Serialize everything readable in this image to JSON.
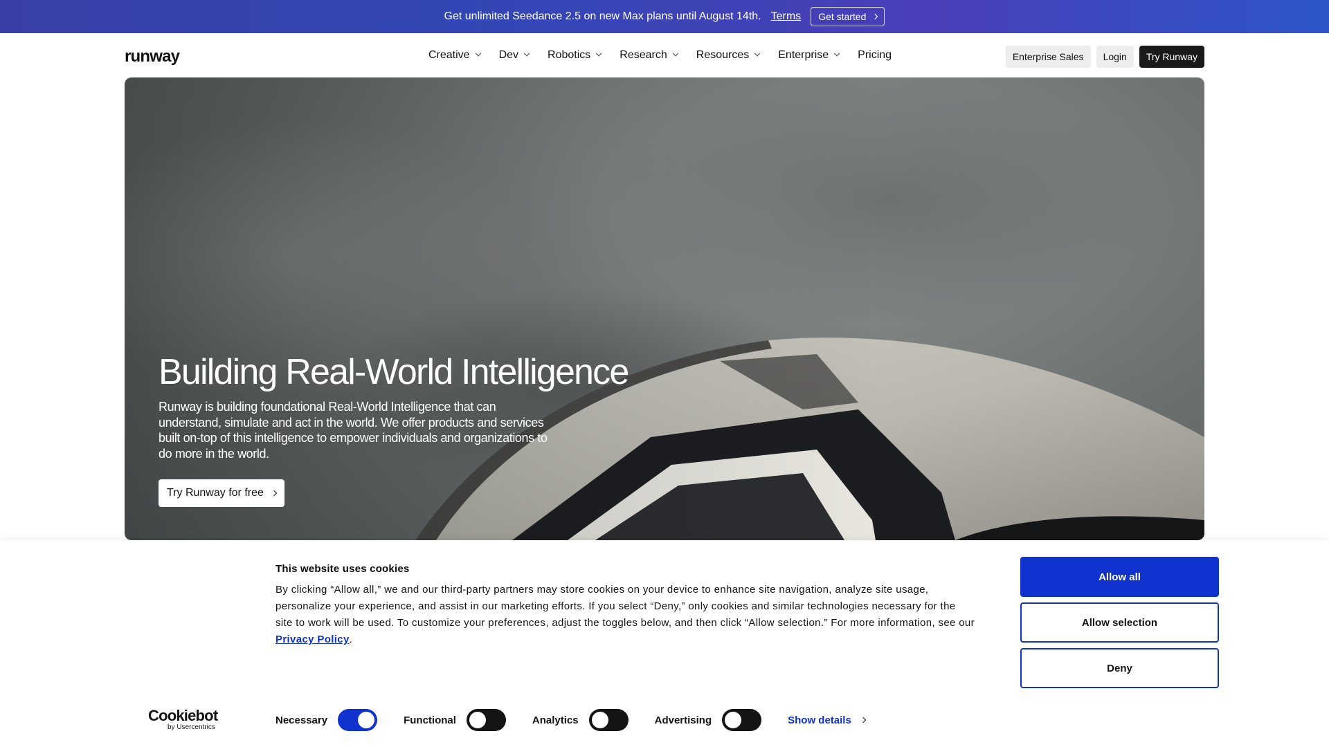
{
  "promo": {
    "text": "Get unlimited Seedance 2.5 on new Max plans until August 14th.",
    "terms": "Terms",
    "cta": "Get started"
  },
  "nav": {
    "logo": "runway",
    "menu": [
      {
        "label": "Creative",
        "has_dropdown": true
      },
      {
        "label": "Dev",
        "has_dropdown": true
      },
      {
        "label": "Robotics",
        "has_dropdown": true
      },
      {
        "label": "Research",
        "has_dropdown": true
      },
      {
        "label": "Resources",
        "has_dropdown": true
      },
      {
        "label": "Enterprise",
        "has_dropdown": true
      },
      {
        "label": "Pricing",
        "has_dropdown": false
      }
    ],
    "enterprise_sales": "Enterprise Sales",
    "login": "Login",
    "try": "Try Runway"
  },
  "hero": {
    "title": "Building Real-World Intelligence",
    "text": "Runway is building foundational Real-World Intelligence that can understand, simulate and act in the world. We offer products and services built on-top of this intelligence to empower individuals and organizations to do more in the world.",
    "cta": "Try Runway for free"
  },
  "cookie": {
    "title": "This website uses cookies",
    "body": "By clicking “Allow all,” we and our third-party partners may store cookies on your device to enhance site navigation, analyze site usage, personalize your experience, and assist in our marketing efforts. If you select “Deny,” only cookies and similar technologies necessary for the site to work will be used. To customize your preferences, adjust the toggles below, and then click “Allow selection.” For more information, see our ",
    "privacy_link": "Privacy Policy",
    "body_end": ".",
    "allow_all": "Allow all",
    "allow_selection": "Allow selection",
    "deny": "Deny",
    "brand": "Cookiebot",
    "brand_by": "by Usercentrics",
    "toggles": [
      {
        "label": "Necessary",
        "on": true
      },
      {
        "label": "Functional",
        "on": false
      },
      {
        "label": "Analytics",
        "on": false
      },
      {
        "label": "Advertising",
        "on": false
      }
    ],
    "show_details": "Show details",
    "accent_color": "#1032cf"
  }
}
